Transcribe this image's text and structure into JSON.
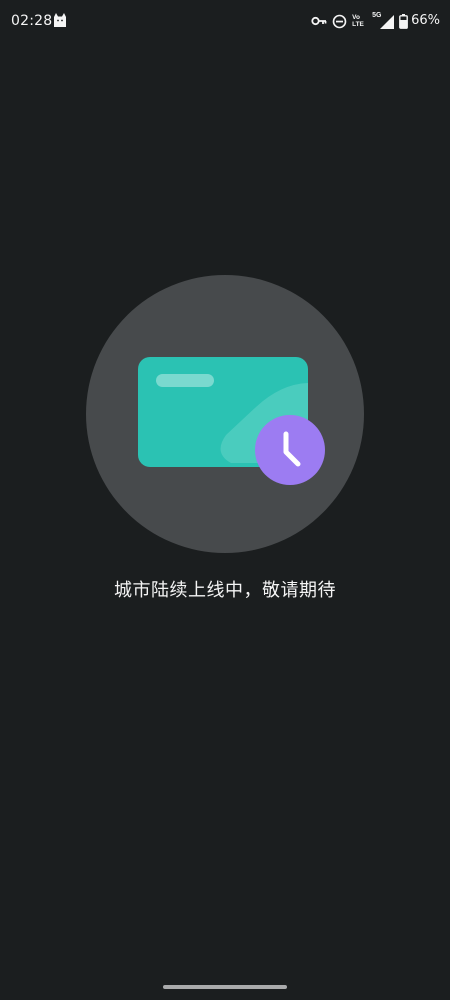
{
  "status_bar": {
    "time": "02:28",
    "notification_icon": "cat-icon",
    "icons": [
      "vpn-key-icon",
      "do-not-disturb-icon",
      "volte-icon",
      "5g-signal-icon",
      "battery-icon"
    ],
    "volte_top": "Vo",
    "volte_bottom": "LTE",
    "network": "5G",
    "battery": "66%"
  },
  "illustration": {
    "card_icon": "card-icon",
    "badge_icon": "clock-icon",
    "colors": {
      "circle": "#474a4c",
      "card": "#2bc2b3",
      "badge": "#9c7cf2"
    }
  },
  "message": "城市陆续上线中，敬请期待"
}
